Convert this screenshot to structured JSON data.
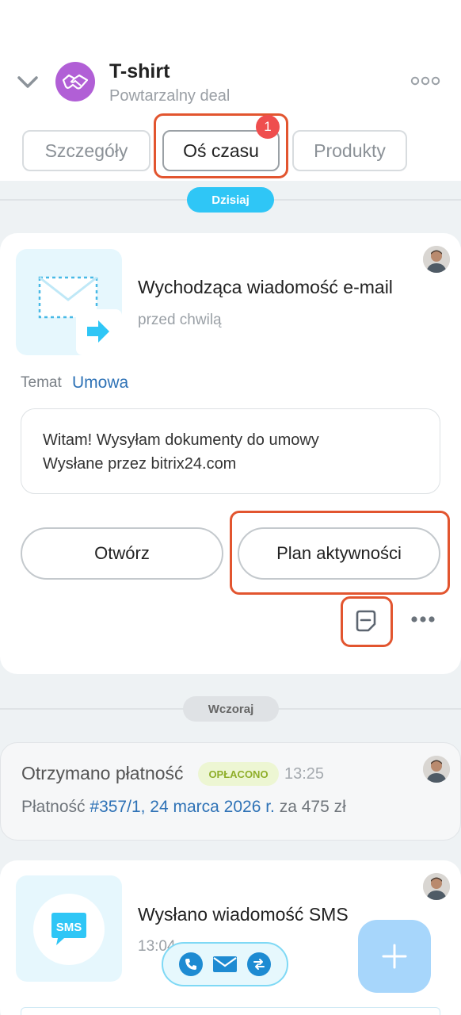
{
  "header": {
    "title": "T-shirt",
    "subtitle": "Powtarzalny deal",
    "collapse_icon": "chevron-down-icon",
    "deal_icon": "handshake-icon",
    "more_icon": "more-dots-icon",
    "avatar_color": "#b15fd6"
  },
  "tabs": [
    {
      "label": "Szczegóły"
    },
    {
      "label": "Oś czasu",
      "badge": "1"
    },
    {
      "label": "Produkty"
    }
  ],
  "timeline": {
    "today_label": "Dzisiaj",
    "yesterday_label": "Wczoraj"
  },
  "email_card": {
    "title": "Wychodząca wiadomość e-mail",
    "time": "przed chwilą",
    "topic_label": "Temat",
    "topic_value": "Umowa",
    "message_line1": "Witam! Wysyłam dokumenty do umowy",
    "message_line2": "Wysłane przez bitrix24.com",
    "open_button": "Otwórz",
    "plan_button": "Plan aktywności"
  },
  "payment_card": {
    "title": "Otrzymano płatność",
    "status": "OPŁACONO",
    "time": "13:25",
    "line_prefix": "Płatność",
    "link": "#357/1, 24 marca 2026 r.",
    "line_suffix": "za 475 zł"
  },
  "sms_card": {
    "title": "Wysłano wiadomość SMS",
    "time": "13:04",
    "icon_label": "SMS"
  },
  "colors": {
    "accent": "#2fc6f6",
    "highlight": "#e2552f",
    "badge": "#ef4e4e",
    "link": "#2e72b6"
  }
}
